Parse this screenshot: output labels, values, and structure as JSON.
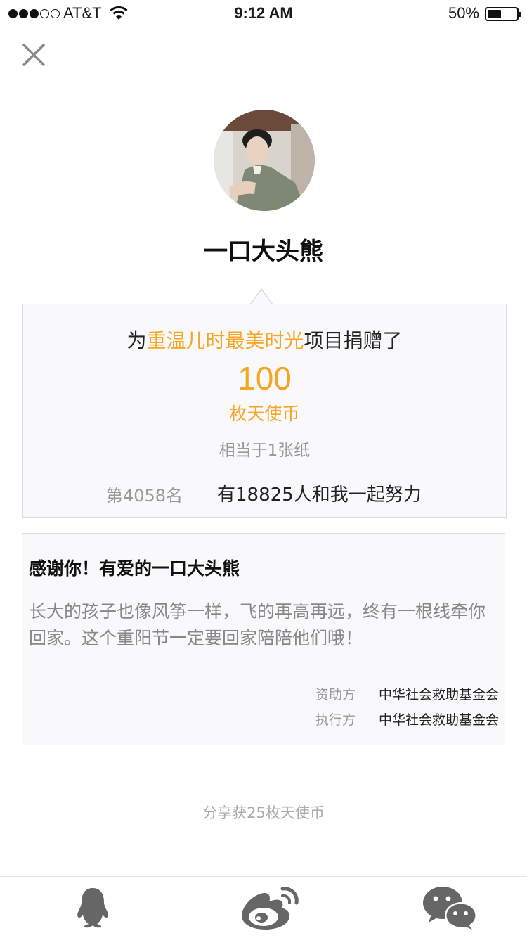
{
  "status_bar": {
    "carrier": "AT&T",
    "time": "9:12 AM",
    "battery": "50%",
    "battery_level": 0.5,
    "signal_bars": 3
  },
  "header": {
    "close_icon": "close-icon"
  },
  "profile": {
    "username": "一口大头熊"
  },
  "donation": {
    "prefix": "为",
    "project": "重温儿时最美时光",
    "suffix": "项目捐赠了",
    "amount": "100",
    "unit": "枚天使币",
    "equivalent": "相当于1张纸",
    "rank": "第4058名",
    "together": "有18825人和我一起努力"
  },
  "thanks": {
    "title": "感谢你！有爱的一口大头熊",
    "message": "长大的孩子也像风筝一样，飞的再高再远，终有一根线牵你回家。这个重阳节一定要回家陪陪他们哦！",
    "sponsor_label": "资助方",
    "sponsor": "中华社会救助基金会",
    "executor_label": "执行方",
    "executor": "中华社会救助基金会"
  },
  "share": {
    "hint": "分享获25枚天使币",
    "targets": [
      "qq-icon",
      "weibo-icon",
      "wechat-icon"
    ]
  },
  "colors": {
    "accent": "#f5a623",
    "icon_gray": "#666666",
    "muted_text": "#999999"
  }
}
